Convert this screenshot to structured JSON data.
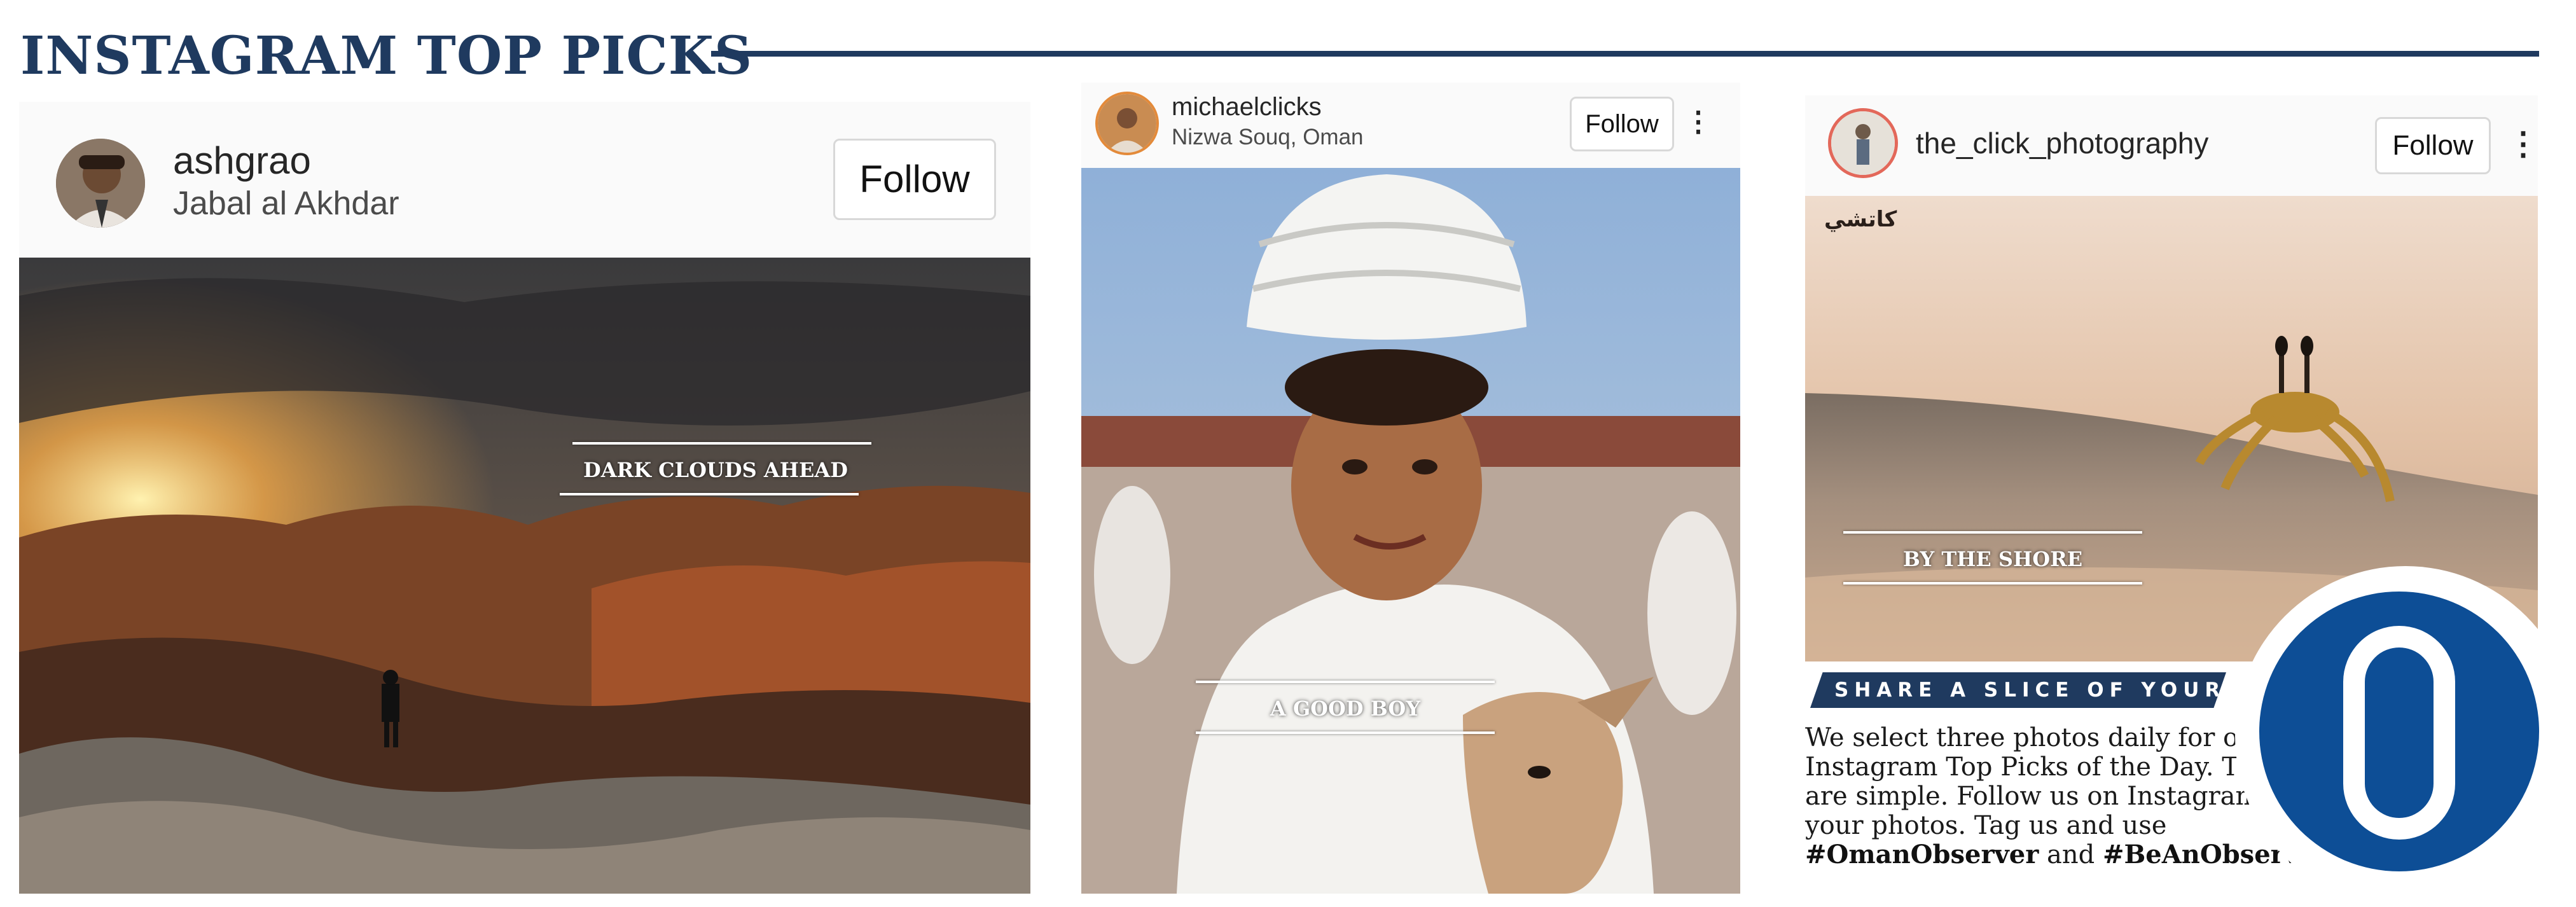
{
  "header": {
    "title": "INSTAGRAM TOP PICKS"
  },
  "posts": [
    {
      "username": "ashgrao",
      "location": "Jabal al Akhdar",
      "follow_label": "Follow",
      "caption": "DARK CLOUDS AHEAD"
    },
    {
      "username": "michaelclicks",
      "location": "Nizwa Souq, Oman",
      "follow_label": "Follow",
      "caption": "A GOOD BOY"
    },
    {
      "username": "the_click_photography",
      "follow_label": "Follow",
      "caption": "BY THE SHORE",
      "watermark": "كاتشي"
    }
  ],
  "promo": {
    "banner": "SHARE A SLICE OF YOUR LIFE",
    "body": "We select three photos daily for our Instagram Top Picks of the Day. The rules are simple. Follow us on Instagram. Upload your photos. Tag us and use",
    "tag1": "#OmanObserver",
    "and_word": "and",
    "tag2": "#BeAnObserver."
  },
  "colors": {
    "navy": "#1f3a5f",
    "logo_blue": "#0d4e96"
  },
  "icons": {
    "more": "more-vertical-icon",
    "logo": "observer-logo"
  }
}
